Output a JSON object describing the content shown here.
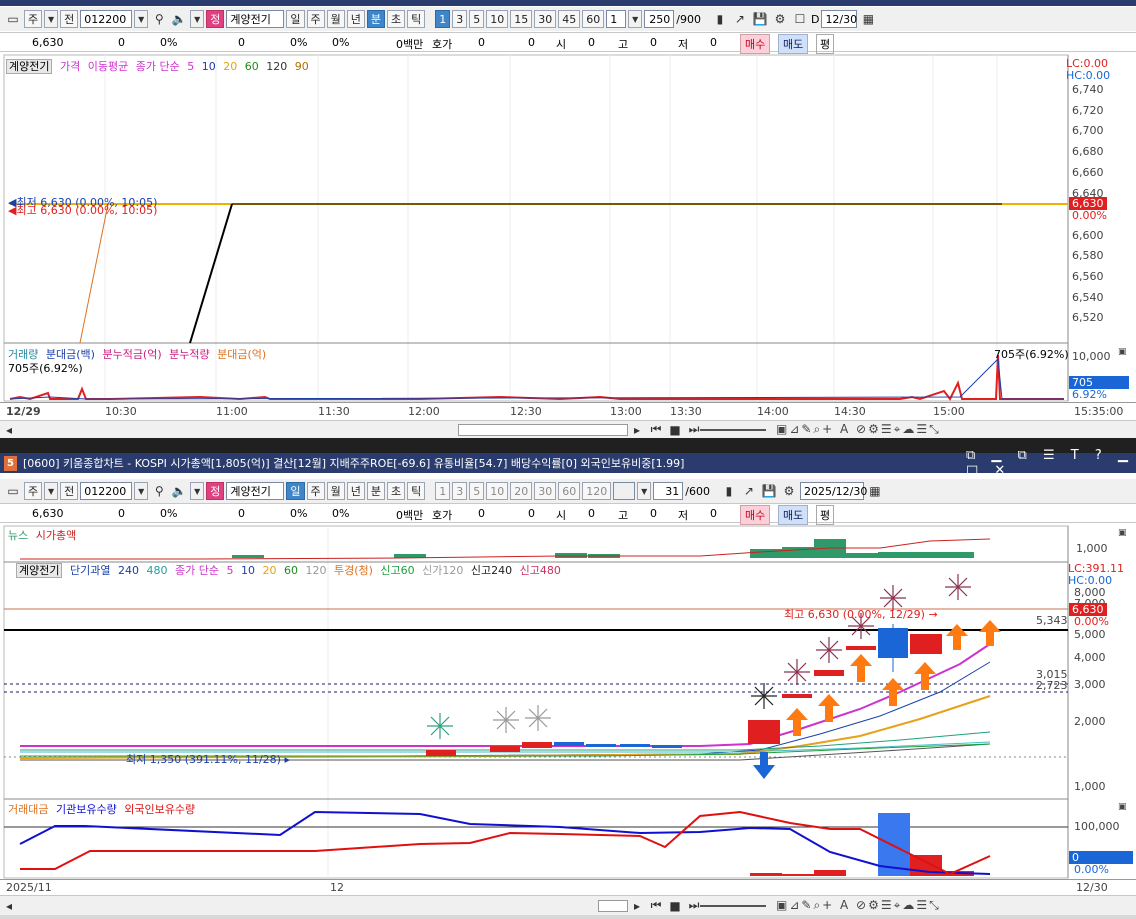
{
  "top": {
    "toolbar": {
      "market": "주",
      "prev": "전",
      "code": "012200",
      "fav_label": "정",
      "name": "계양전기",
      "periods": [
        "일",
        "주",
        "월",
        "년",
        "분",
        "초",
        "틱"
      ],
      "selected_period": "분",
      "intervals": [
        "1",
        "3",
        "5",
        "10",
        "15",
        "30",
        "45",
        "60"
      ],
      "selected_interval": "1",
      "interval_select": "1",
      "count": "250",
      "count_total": "/900",
      "checkbox_label": "D",
      "date": "12/30"
    },
    "quote": {
      "price": "6,630",
      "change": "0",
      "change_pct": "0%",
      "volume": "0",
      "vol_pct": "0%",
      "pct2": "0%",
      "amount": "0백만",
      "hoga_label": "호가",
      "hoga1": "0",
      "hoga2": "0",
      "open_label": "시",
      "open": "0",
      "high_label": "고",
      "high": "0",
      "low_label": "저",
      "low": "0",
      "buy": "매수",
      "sell": "매도",
      "eval": "평"
    },
    "price_legend": {
      "name": "계양전기",
      "price": "가격",
      "ma": "이동평균",
      "ma_type": "종가 단순",
      "ma_periods": [
        "5",
        "10",
        "20",
        "60",
        "120",
        "90"
      ]
    },
    "lc": "LC:0.00",
    "hc": "HC:0.00",
    "y_ticks": [
      "6,740",
      "6,720",
      "6,700",
      "6,680",
      "6,660",
      "6,640",
      "6,600",
      "6,580",
      "6,560",
      "6,540",
      "6,520"
    ],
    "price_tag": "6,630",
    "price_pct": "0.00%",
    "high_note": "최저 6,630 (0.00%, 10:05)",
    "high_note2": "최고 6,630 (0.00%, 10:05)",
    "vol_legend": {
      "vol": "거래량",
      "amount": "분대금(백)",
      "cum_amount": "분누적금(억)",
      "cum_vol": "분누적량",
      "amount2": "분대금(억)"
    },
    "vol_note": "705주(6.92%)",
    "vol_note_right": "705주(6.92%)",
    "vol_axis": "10,000",
    "vol_tag": "705",
    "vol_pct": "6.92%",
    "x_labels": [
      "12/29",
      "10:30",
      "11:00",
      "11:30",
      "12:00",
      "12:30",
      "13:00",
      "13:30",
      "14:00",
      "14:30",
      "15:00"
    ],
    "x_right": "15:35:00"
  },
  "bottom": {
    "title_badge": "5",
    "title": "[0600] 키움종합차트 - KOSPI 시가총액[1,805(억)] 결산[12월] 지배주주ROE[-69.6] 유통비율[54.7] 배당수익률[0] 외국인보유비중[1.99]",
    "toolbar": {
      "market": "주",
      "prev": "전",
      "code": "012200",
      "fav_label": "정",
      "name": "계양전기",
      "periods": [
        "일",
        "주",
        "월",
        "년",
        "분",
        "초",
        "틱"
      ],
      "selected_period": "일",
      "intervals": [
        "1",
        "3",
        "5",
        "10",
        "20",
        "30",
        "60",
        "120"
      ],
      "count": "31",
      "count_total": "/600",
      "date": "2025/12/30"
    },
    "quote": {
      "price": "6,630",
      "change": "0",
      "change_pct": "0%",
      "volume": "0",
      "vol_pct": "0%",
      "pct2": "0%",
      "amount": "0백만",
      "hoga_label": "호가",
      "hoga1": "0",
      "hoga2": "0",
      "open_label": "시",
      "open": "0",
      "high_label": "고",
      "high": "0",
      "low_label": "저",
      "low": "0",
      "buy": "매수",
      "sell": "매도",
      "eval": "평"
    },
    "news_legend": {
      "news": "뉴스",
      "cap": "시가총액"
    },
    "news_axis": "1,000",
    "price_legend": {
      "name": "계양전기",
      "short_over": "단기과열",
      "n240": "240",
      "n480": "480",
      "ma_type": "종가 단순",
      "ma_periods": [
        "5",
        "10",
        "20",
        "60",
        "120"
      ],
      "invest": "투경(청)",
      "high60": "신고60",
      "new120": "신가120",
      "high240": "신고240",
      "high480": "신고480"
    },
    "lc": "LC:391.11",
    "hc": "HC:0.00",
    "y_ticks": [
      "8,000",
      "7,000",
      "5,000",
      "4,000",
      "3,000",
      "2,000",
      "1,000"
    ],
    "level1": "5,343",
    "level2": "3,015",
    "level3": "2,723",
    "price_tag": "6,630",
    "price_pct": "0.00%",
    "high_note": "최고 6,630 (0.00%, 12/29)",
    "low_note": "최저 1,350 (391.11%, 11/28)",
    "flow_legend": {
      "amount": "거래대금",
      "inst": "기관보유수량",
      "foreign": "외국인보유수량"
    },
    "flow_axis": "100,000",
    "flow_tag": "0",
    "flow_pct": "0.00%",
    "x_left": "2025/11",
    "x_mid": "12",
    "x_right": "12/30"
  },
  "colors": {
    "up": "#e02020",
    "down": "#1a66d6",
    "arrow_up": "#ff7a10",
    "ma5": "#cc33cc",
    "ma10": "#1a3fa8",
    "ma20": "#e8a018",
    "titlebar": "#2a3b6e"
  }
}
